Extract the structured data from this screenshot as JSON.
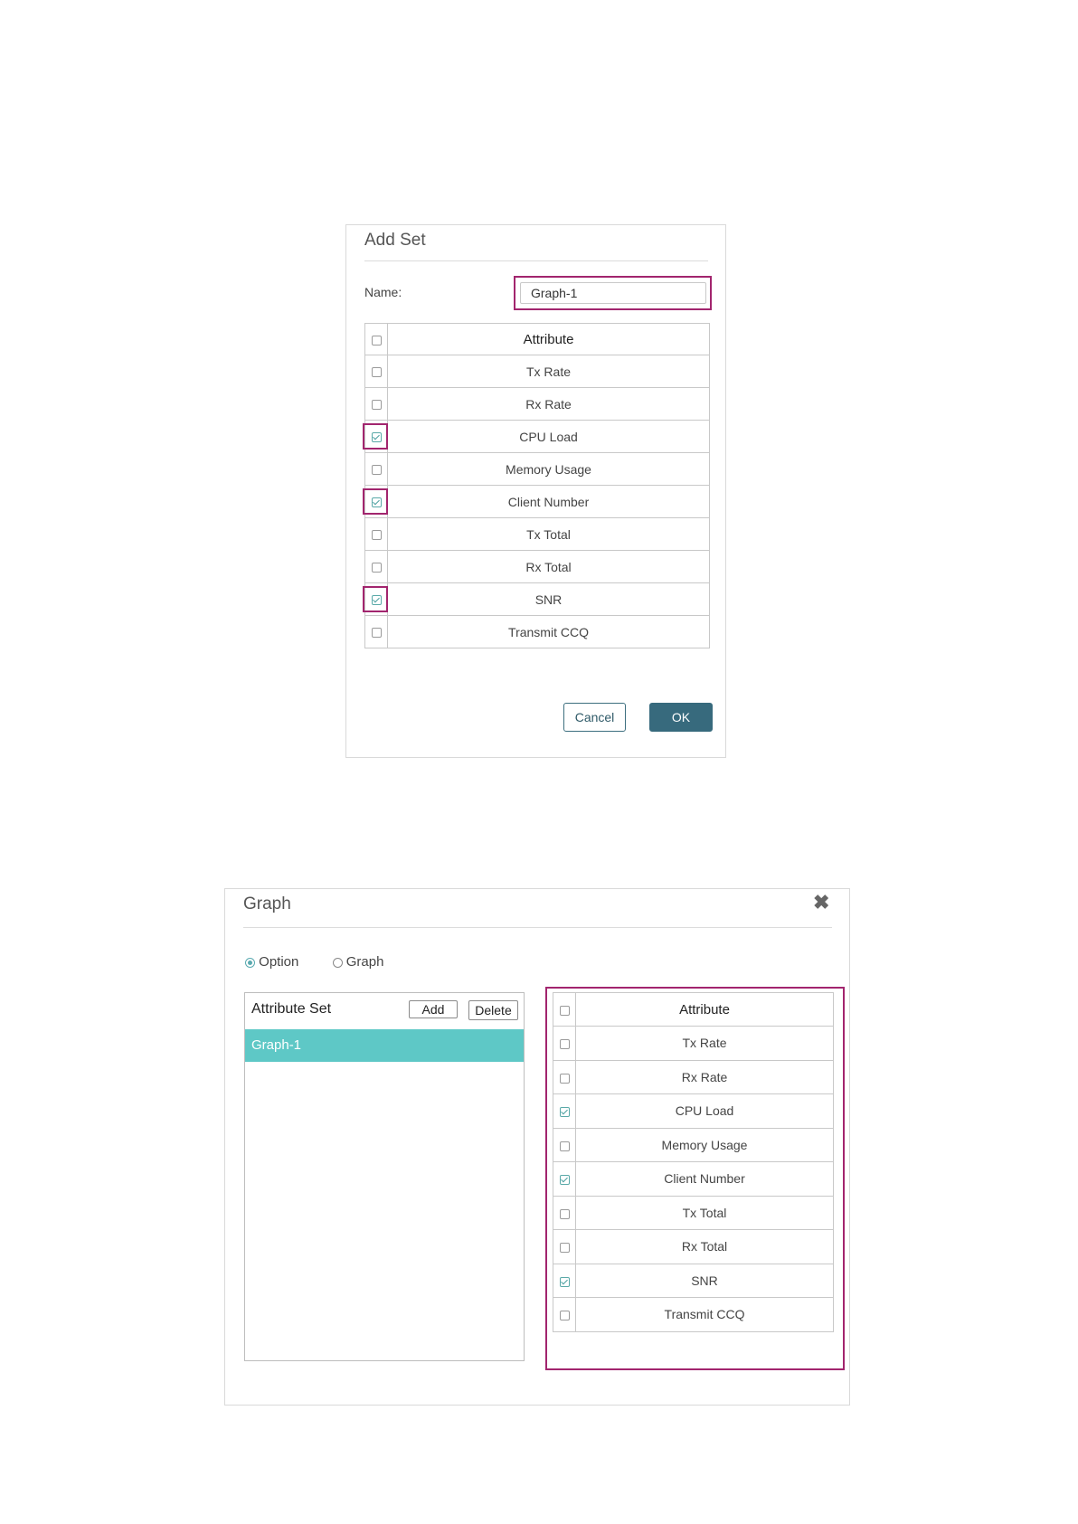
{
  "add_set": {
    "title": "Add Set",
    "name_label": "Name:",
    "name_value": "Graph-1",
    "header": "Attribute",
    "rows": [
      {
        "label": "Tx Rate",
        "checked": false
      },
      {
        "label": "Rx Rate",
        "checked": false
      },
      {
        "label": "CPU Load",
        "checked": true
      },
      {
        "label": "Memory Usage",
        "checked": false
      },
      {
        "label": "Client Number",
        "checked": true
      },
      {
        "label": "Tx Total",
        "checked": false
      },
      {
        "label": "Rx Total",
        "checked": false
      },
      {
        "label": "SNR",
        "checked": true
      },
      {
        "label": "Transmit CCQ",
        "checked": false
      }
    ],
    "cancel_label": "Cancel",
    "ok_label": "OK"
  },
  "graph": {
    "title": "Graph",
    "close_glyph": "✖",
    "radio_option": "Option",
    "radio_graph": "Graph",
    "attribute_set_label": "Attribute Set",
    "add_label": "Add",
    "delete_label": "Delete",
    "sets": [
      "Graph-1"
    ],
    "header": "Attribute",
    "rows": [
      {
        "label": "Tx Rate",
        "checked": false
      },
      {
        "label": "Rx Rate",
        "checked": false
      },
      {
        "label": "CPU Load",
        "checked": true
      },
      {
        "label": "Memory Usage",
        "checked": false
      },
      {
        "label": "Client Number",
        "checked": true
      },
      {
        "label": "Tx Total",
        "checked": false
      },
      {
        "label": "Rx Total",
        "checked": false
      },
      {
        "label": "SNR",
        "checked": true
      },
      {
        "label": "Transmit CCQ",
        "checked": false
      }
    ]
  },
  "colors": {
    "highlight": "#a2256e",
    "selected_row": "#5ec8c6",
    "primary_button": "#376a7d",
    "check": "#5aa9a8"
  }
}
